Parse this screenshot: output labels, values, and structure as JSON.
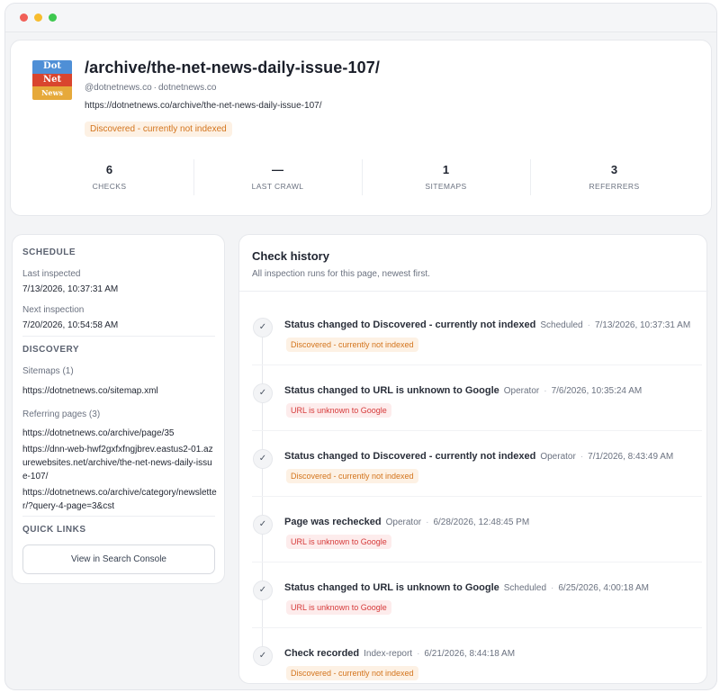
{
  "page": {
    "path": "/archive/the-net-news-daily-issue-107/",
    "handle": "@dotnetnews.co",
    "domain": "dotnetnews.co",
    "url": "https://dotnetnews.co/archive/the-net-news-daily-issue-107/",
    "status": "Discovered - currently not indexed",
    "logo": {
      "line1": "Dot",
      "line2": "Net",
      "line3": "News"
    }
  },
  "stats": [
    {
      "value": "6",
      "label": "CHECKS"
    },
    {
      "value": "—",
      "label": "LAST CRAWL"
    },
    {
      "value": "1",
      "label": "SITEMAPS"
    },
    {
      "value": "3",
      "label": "REFERRERS"
    }
  ],
  "sidebar": {
    "schedule_title": "SCHEDULE",
    "last_inspected_label": "Last inspected",
    "last_inspected": "7/13/2026, 10:37:31 AM",
    "next_inspection_label": "Next inspection",
    "next_inspection": "7/20/2026, 10:54:58 AM",
    "discovery_title": "DISCOVERY",
    "sitemaps_label": "Sitemaps (1)",
    "sitemaps": [
      "https://dotnetnews.co/sitemap.xml"
    ],
    "referring_label": "Referring pages (3)",
    "referring": [
      "https://dotnetnews.co/archive/page/35",
      "https://dnn-web-hwf2gxfxfngjbrev.eastus2-01.azurewebsites.net/archive/the-net-news-daily-issue-107/",
      "https://dotnetnews.co/archive/category/newsletter/?query-4-page=3&cst"
    ],
    "quick_links_title": "QUICK LINKS",
    "console_button": "View in Search Console"
  },
  "history": {
    "title": "Check history",
    "subtitle": "All inspection runs for this page, newest first.",
    "check_glyph": "✓",
    "separator": "·",
    "entries": [
      {
        "title": "Status changed to Discovered - currently not indexed",
        "source": "Scheduled",
        "time": "7/13/2026, 10:37:31 AM",
        "badge": "Discovered - currently not indexed",
        "badge_color": "#d3741c"
      },
      {
        "title": "Status changed to URL is unknown to Google",
        "source": "Operator",
        "time": "7/6/2026, 10:35:24 AM",
        "badge": "URL is unknown to Google",
        "badge_color": "#d63a3a"
      },
      {
        "title": "Status changed to Discovered - currently not indexed",
        "source": "Operator",
        "time": "7/1/2026, 8:43:49 AM",
        "badge": "Discovered - currently not indexed",
        "badge_color": "#d3741c"
      },
      {
        "title": "Page was rechecked",
        "source": "Operator",
        "time": "6/28/2026, 12:48:45 PM",
        "badge": "URL is unknown to Google",
        "badge_color": "#d63a3a"
      },
      {
        "title": "Status changed to URL is unknown to Google",
        "source": "Scheduled",
        "time": "6/25/2026, 4:00:18 AM",
        "badge": "URL is unknown to Google",
        "badge_color": "#d63a3a"
      },
      {
        "title": "Check recorded",
        "source": "Index-report",
        "time": "6/21/2026, 8:44:18 AM",
        "badge": "Discovered - currently not indexed",
        "badge_color": "#d3741c"
      }
    ]
  }
}
